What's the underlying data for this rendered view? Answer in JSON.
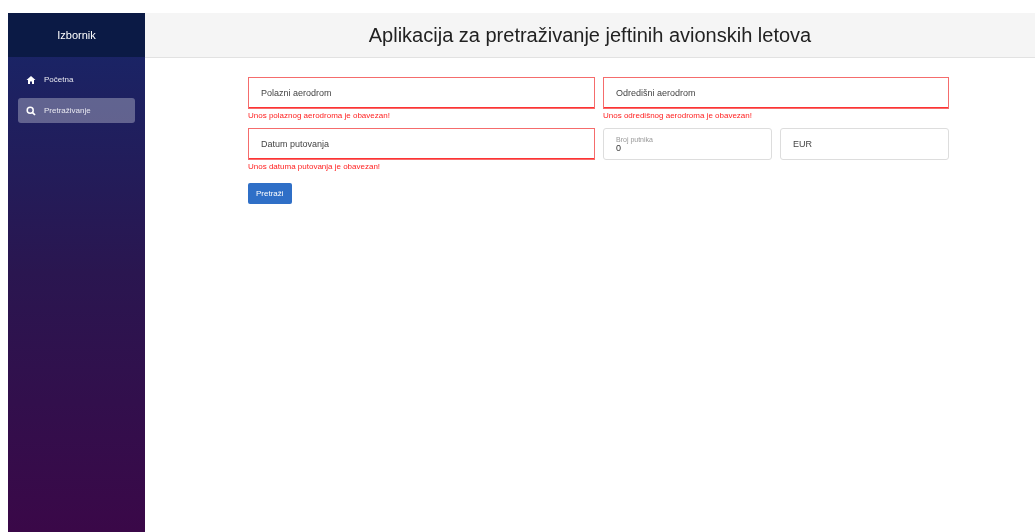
{
  "sidebar": {
    "title": "Izbornik",
    "items": [
      {
        "label": "Početna",
        "kind": "home",
        "selected": false
      },
      {
        "label": "Pretraživanje",
        "kind": "search",
        "selected": true
      }
    ]
  },
  "header": {
    "title": "Aplikacija za pretraživanje jeftinih avionskih letova"
  },
  "form": {
    "fields": [
      {
        "kind": "text",
        "placeholder": "Polazni aerodrom",
        "invalid": true,
        "error": "Unos polaznog aerodroma je obavezan!"
      },
      {
        "kind": "text",
        "placeholder": "Odredišni aerodrom",
        "invalid": true,
        "error": "Unos odredišnog aerodroma je obavezan!"
      },
      {
        "kind": "text",
        "placeholder": "Datum putovanja",
        "invalid": true,
        "error": "Unos datuma putovanja je obavezan!"
      },
      {
        "kind": "number",
        "label": "Broj putnika",
        "value": "0",
        "invalid": false
      },
      {
        "kind": "select",
        "value": "EUR",
        "invalid": false
      }
    ],
    "submit": "Pretraži"
  }
}
